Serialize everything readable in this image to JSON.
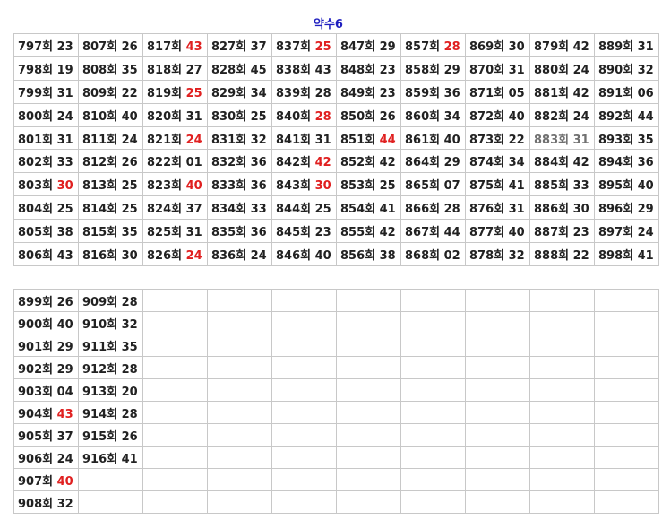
{
  "title": "약수6",
  "colors": {
    "highlight": "#e02020",
    "normal": "#222222",
    "muted": "#707070",
    "title": "#1f1fbf"
  },
  "table1": {
    "rows": [
      [
        {
          "e": "797회",
          "n": "23"
        },
        {
          "e": "807회",
          "n": "26"
        },
        {
          "e": "817회",
          "n": "43",
          "h": "red"
        },
        {
          "e": "827회",
          "n": "37"
        },
        {
          "e": "837회",
          "n": "25",
          "h": "red"
        },
        {
          "e": "847회",
          "n": "29"
        },
        {
          "e": "857회",
          "n": "28",
          "h": "red"
        },
        {
          "e": "869회",
          "n": "30"
        },
        {
          "e": "879회",
          "n": "42"
        },
        {
          "e": "889회",
          "n": "31"
        }
      ],
      [
        {
          "e": "798회",
          "n": "19"
        },
        {
          "e": "808회",
          "n": "35"
        },
        {
          "e": "818회",
          "n": "27"
        },
        {
          "e": "828회",
          "n": "45"
        },
        {
          "e": "838회",
          "n": "43"
        },
        {
          "e": "848회",
          "n": "23"
        },
        {
          "e": "858회",
          "n": "29"
        },
        {
          "e": "870회",
          "n": "31"
        },
        {
          "e": "880회",
          "n": "24"
        },
        {
          "e": "890회",
          "n": "32"
        }
      ],
      [
        {
          "e": "799회",
          "n": "31"
        },
        {
          "e": "809회",
          "n": "22"
        },
        {
          "e": "819회",
          "n": "25",
          "h": "red"
        },
        {
          "e": "829회",
          "n": "34"
        },
        {
          "e": "839회",
          "n": "28"
        },
        {
          "e": "849회",
          "n": "23"
        },
        {
          "e": "859회",
          "n": "36"
        },
        {
          "e": "871회",
          "n": "05"
        },
        {
          "e": "881회",
          "n": "42"
        },
        {
          "e": "891회",
          "n": "06"
        }
      ],
      [
        {
          "e": "800회",
          "n": "24"
        },
        {
          "e": "810회",
          "n": "40"
        },
        {
          "e": "820회",
          "n": "31"
        },
        {
          "e": "830회",
          "n": "25"
        },
        {
          "e": "840회",
          "n": "28",
          "h": "red"
        },
        {
          "e": "850회",
          "n": "26"
        },
        {
          "e": "860회",
          "n": "34"
        },
        {
          "e": "872회",
          "n": "40"
        },
        {
          "e": "882회",
          "n": "24"
        },
        {
          "e": "892회",
          "n": "44"
        }
      ],
      [
        {
          "e": "801회",
          "n": "31"
        },
        {
          "e": "811회",
          "n": "24"
        },
        {
          "e": "821회",
          "n": "24",
          "h": "red"
        },
        {
          "e": "831회",
          "n": "32"
        },
        {
          "e": "841회",
          "n": "31"
        },
        {
          "e": "851회",
          "n": "44",
          "h": "red"
        },
        {
          "e": "861회",
          "n": "40"
        },
        {
          "e": "873회",
          "n": "22"
        },
        {
          "e": "883회",
          "n": "31",
          "h": "gray"
        },
        {
          "e": "893회",
          "n": "35"
        }
      ],
      [
        {
          "e": "802회",
          "n": "33"
        },
        {
          "e": "812회",
          "n": "26"
        },
        {
          "e": "822회",
          "n": "01"
        },
        {
          "e": "832회",
          "n": "36"
        },
        {
          "e": "842회",
          "n": "42",
          "h": "red"
        },
        {
          "e": "852회",
          "n": "42"
        },
        {
          "e": "864회",
          "n": "29"
        },
        {
          "e": "874회",
          "n": "34"
        },
        {
          "e": "884회",
          "n": "42"
        },
        {
          "e": "894회",
          "n": "36"
        }
      ],
      [
        {
          "e": "803회",
          "n": "30",
          "h": "red"
        },
        {
          "e": "813회",
          "n": "25"
        },
        {
          "e": "823회",
          "n": "40",
          "h": "red"
        },
        {
          "e": "833회",
          "n": "36"
        },
        {
          "e": "843회",
          "n": "30",
          "h": "red"
        },
        {
          "e": "853회",
          "n": "25"
        },
        {
          "e": "865회",
          "n": "07"
        },
        {
          "e": "875회",
          "n": "41"
        },
        {
          "e": "885회",
          "n": "33"
        },
        {
          "e": "895회",
          "n": "40"
        }
      ],
      [
        {
          "e": "804회",
          "n": "25"
        },
        {
          "e": "814회",
          "n": "25"
        },
        {
          "e": "824회",
          "n": "37"
        },
        {
          "e": "834회",
          "n": "33"
        },
        {
          "e": "844회",
          "n": "25"
        },
        {
          "e": "854회",
          "n": "41"
        },
        {
          "e": "866회",
          "n": "28"
        },
        {
          "e": "876회",
          "n": "31"
        },
        {
          "e": "886회",
          "n": "30"
        },
        {
          "e": "896회",
          "n": "29"
        }
      ],
      [
        {
          "e": "805회",
          "n": "38"
        },
        {
          "e": "815회",
          "n": "35"
        },
        {
          "e": "825회",
          "n": "31"
        },
        {
          "e": "835회",
          "n": "36"
        },
        {
          "e": "845회",
          "n": "23"
        },
        {
          "e": "855회",
          "n": "42"
        },
        {
          "e": "867회",
          "n": "44"
        },
        {
          "e": "877회",
          "n": "40"
        },
        {
          "e": "887회",
          "n": "23"
        },
        {
          "e": "897회",
          "n": "24"
        }
      ],
      [
        {
          "e": "806회",
          "n": "43"
        },
        {
          "e": "816회",
          "n": "30"
        },
        {
          "e": "826회",
          "n": "24",
          "h": "red"
        },
        {
          "e": "836회",
          "n": "24"
        },
        {
          "e": "846회",
          "n": "40"
        },
        {
          "e": "856회",
          "n": "38"
        },
        {
          "e": "868회",
          "n": "02"
        },
        {
          "e": "878회",
          "n": "32"
        },
        {
          "e": "888회",
          "n": "22"
        },
        {
          "e": "898회",
          "n": "41"
        }
      ]
    ]
  },
  "table2": {
    "rows": [
      [
        {
          "e": "899회",
          "n": "26"
        },
        {
          "e": "909회",
          "n": "28"
        },
        null,
        null,
        null,
        null,
        null,
        null,
        null,
        null
      ],
      [
        {
          "e": "900회",
          "n": "40"
        },
        {
          "e": "910회",
          "n": "32"
        },
        null,
        null,
        null,
        null,
        null,
        null,
        null,
        null
      ],
      [
        {
          "e": "901회",
          "n": "29"
        },
        {
          "e": "911회",
          "n": "35"
        },
        null,
        null,
        null,
        null,
        null,
        null,
        null,
        null
      ],
      [
        {
          "e": "902회",
          "n": "29"
        },
        {
          "e": "912회",
          "n": "28"
        },
        null,
        null,
        null,
        null,
        null,
        null,
        null,
        null
      ],
      [
        {
          "e": "903회",
          "n": "04"
        },
        {
          "e": "913회",
          "n": "20"
        },
        null,
        null,
        null,
        null,
        null,
        null,
        null,
        null
      ],
      [
        {
          "e": "904회",
          "n": "43",
          "h": "red"
        },
        {
          "e": "914회",
          "n": "28"
        },
        null,
        null,
        null,
        null,
        null,
        null,
        null,
        null
      ],
      [
        {
          "e": "905회",
          "n": "37"
        },
        {
          "e": "915회",
          "n": "26"
        },
        null,
        null,
        null,
        null,
        null,
        null,
        null,
        null
      ],
      [
        {
          "e": "906회",
          "n": "24"
        },
        {
          "e": "916회",
          "n": "41"
        },
        null,
        null,
        null,
        null,
        null,
        null,
        null,
        null
      ],
      [
        {
          "e": "907회",
          "n": "40",
          "h": "red"
        },
        null,
        null,
        null,
        null,
        null,
        null,
        null,
        null,
        null
      ],
      [
        {
          "e": "908회",
          "n": "32"
        },
        null,
        null,
        null,
        null,
        null,
        null,
        null,
        null,
        null
      ]
    ]
  }
}
